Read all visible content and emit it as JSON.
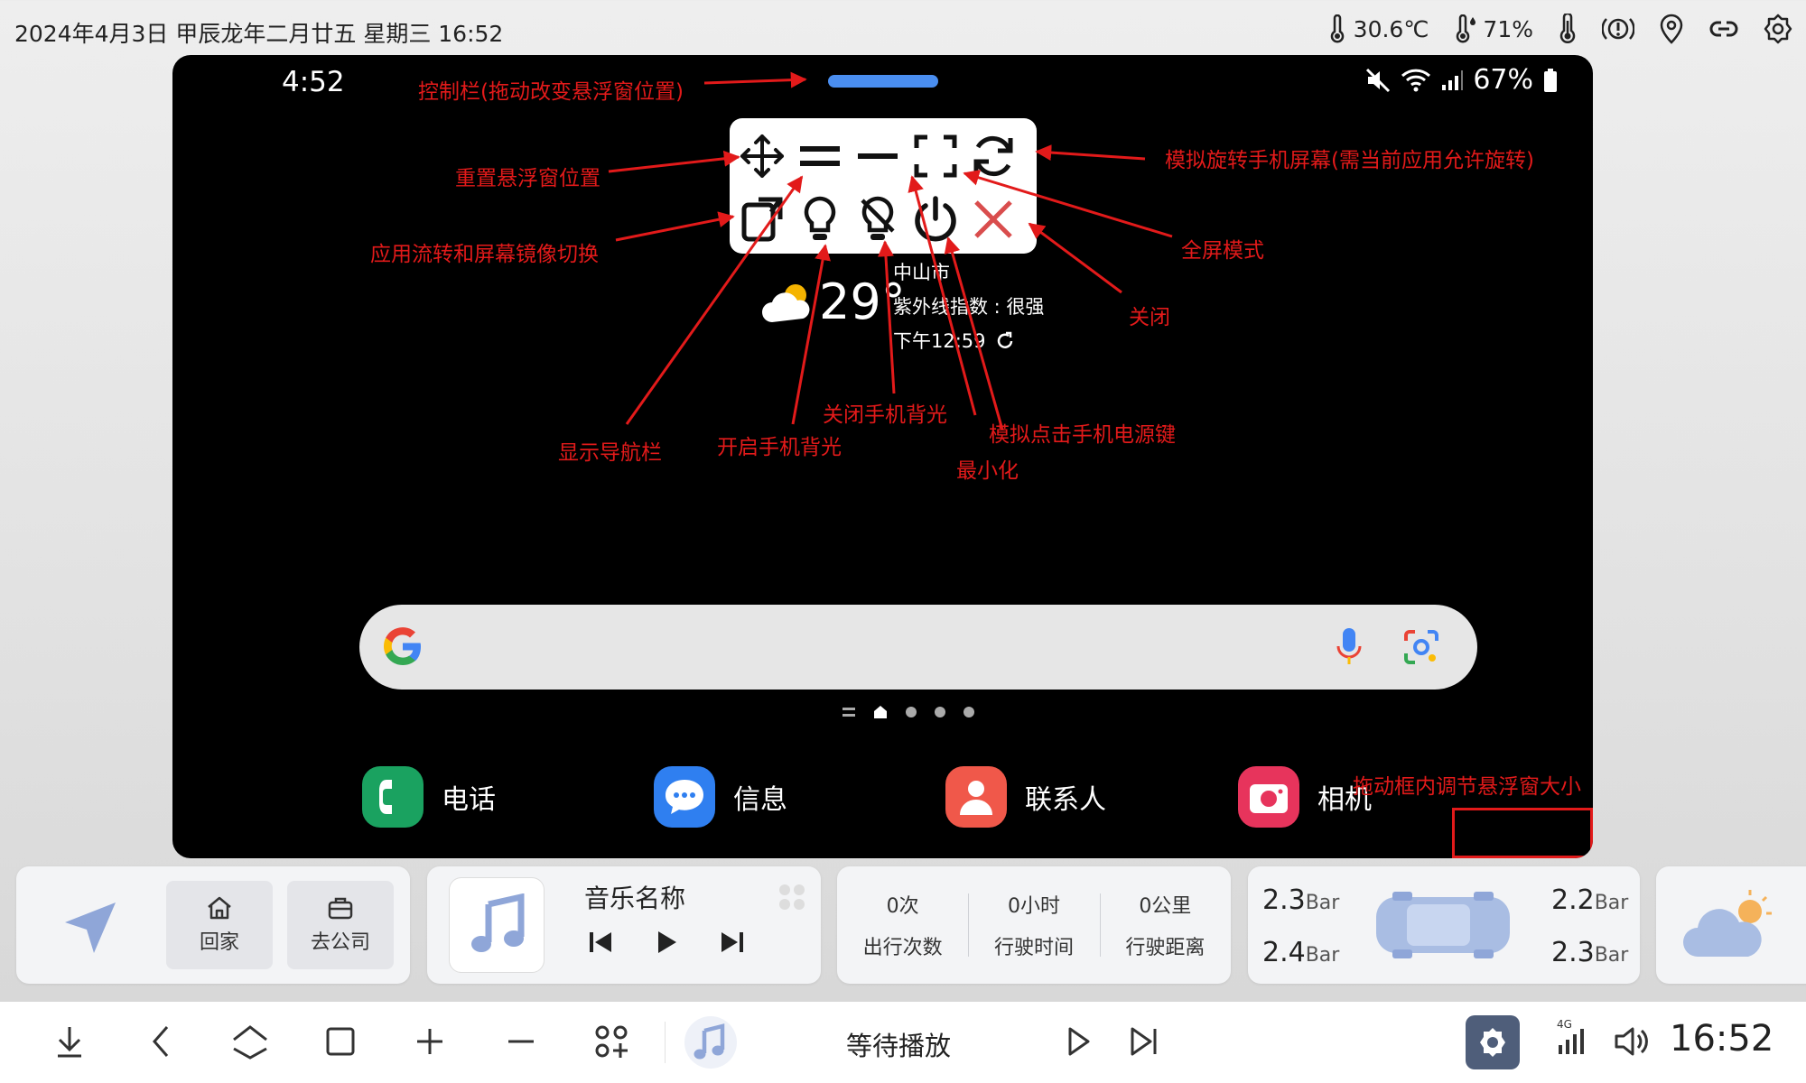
{
  "status_bar": {
    "datetime": "2024年4月3日  甲辰龙年二月廿五  星期三  16:52",
    "temperature": "30.6℃",
    "humidity": "71%"
  },
  "phone": {
    "time": "4:52",
    "battery": "67%",
    "weather": {
      "temperature": "29°",
      "city": "中山市",
      "uv_index": "紫外线指数 : 很强",
      "updated": "下午12:59"
    },
    "dock_apps": [
      {
        "label": "电话",
        "color": "#1aa260"
      },
      {
        "label": "信息",
        "color": "#2f7ff0"
      },
      {
        "label": "联系人",
        "color": "#f0584a"
      },
      {
        "label": "相机",
        "color": "#e7345c"
      }
    ]
  },
  "annotations": {
    "control_bar": "控制栏(拖动改变悬浮窗位置)",
    "reset_position": "重置悬浮窗位置",
    "app_flow": "应用流转和屏幕镜像切换",
    "rotate": "模拟旋转手机屏幕(需当前应用允许旋转)",
    "fullscreen": "全屏模式",
    "close": "关闭",
    "show_nav": "显示导航栏",
    "backlight_on": "开启手机背光",
    "backlight_off": "关闭手机背光",
    "power_key": "模拟点击手机电源键",
    "minimize": "最小化",
    "resize": "拖动框内调节悬浮窗大小"
  },
  "cards": {
    "nav": {
      "home": "回家",
      "work": "去公司"
    },
    "music": {
      "title": "音乐名称"
    },
    "trip": [
      {
        "value": "0次",
        "label": "出行次数"
      },
      {
        "value": "0小时",
        "label": "行驶时间"
      },
      {
        "value": "0公里",
        "label": "行驶距离"
      }
    ],
    "tires": {
      "front_left": "2.3",
      "front_right": "2.2",
      "rear_left": "2.4",
      "rear_right": "2.3",
      "unit": "Bar"
    }
  },
  "bottom_bar": {
    "playback_status": "等待播放",
    "network": "4G",
    "clock": "16:52"
  },
  "colors": {
    "annotation": "#e21a1a",
    "accent": "#4a8ef0",
    "card_icon": "#8fa6d8"
  }
}
